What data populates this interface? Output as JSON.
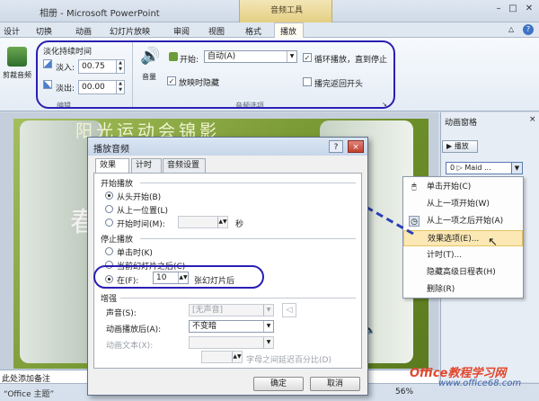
{
  "window": {
    "title": "相册 - Microsoft PowerPoint",
    "context_tab": "音频工具"
  },
  "tabs": [
    "设计",
    "切换",
    "动画",
    "幻灯片放映",
    "审阅",
    "视图",
    "格式",
    "播放"
  ],
  "ribbon": {
    "clip_label": "剪裁音频",
    "fade_title": "淡化持续时间",
    "fade_in_label": "淡入:",
    "fade_in_value": "00.75",
    "fade_out_label": "淡出:",
    "fade_out_value": "00.00",
    "edit_group": "编辑",
    "volume_label": "音量",
    "start_label": "开始:",
    "start_value": "自动(A)",
    "hide_label": "放映时隐藏",
    "loop_label": "循环播放，直到停止",
    "rewind_label": "播完返回开头",
    "audio_options_group": "音频选项"
  },
  "slide": {
    "title": "阳光运动会锦影",
    "char": "春"
  },
  "notes": {
    "text": "此处添加备注"
  },
  "status": {
    "theme": "“Office 主题”",
    "zoom": "56%"
  },
  "animation_pane": {
    "title": "动画窗格",
    "play_button": "播放",
    "item": "0 ▷ Maid ..."
  },
  "context_menu": {
    "items": [
      "单击开始(C)",
      "从上一项开始(W)",
      "从上一项之后开始(A)",
      "效果选项(E)...",
      "计时(T)...",
      "隐藏高级日程表(H)",
      "删除(R)"
    ]
  },
  "dialog": {
    "title": "播放音频",
    "help": "?",
    "close": "×",
    "tabs": [
      "效果",
      "计时",
      "音频设置"
    ],
    "start_section": "开始播放",
    "start_options": [
      "从头开始(B)",
      "从上一位置(L)",
      "开始时间(M):"
    ],
    "start_unit": "秒",
    "stop_section": "停止播放",
    "stop_options": [
      "单击时(K)",
      "当前幻灯片之后(C)",
      "在(F):"
    ],
    "stop_value": "10",
    "stop_unit": "张幻灯片后",
    "enhance_section": "增强",
    "sound_label": "声音(S):",
    "sound_value": "[无声音]",
    "after_label": "动画播放后(A):",
    "after_value": "不变暗",
    "text_label": "动画文本(X):",
    "text_value": "",
    "delay_label": "字母之间延迟百分比(D)",
    "ok": "确定",
    "cancel": "取消"
  },
  "watermark": {
    "line1": "Office教程学习网",
    "line2": "www.office68.com"
  },
  "colors": {
    "annotation_oval": "#2a1fb3",
    "arrow": "#2a3fb8",
    "menu_highlight": "#fbe8b4",
    "ribbon_contextual": "#e3cf83"
  }
}
